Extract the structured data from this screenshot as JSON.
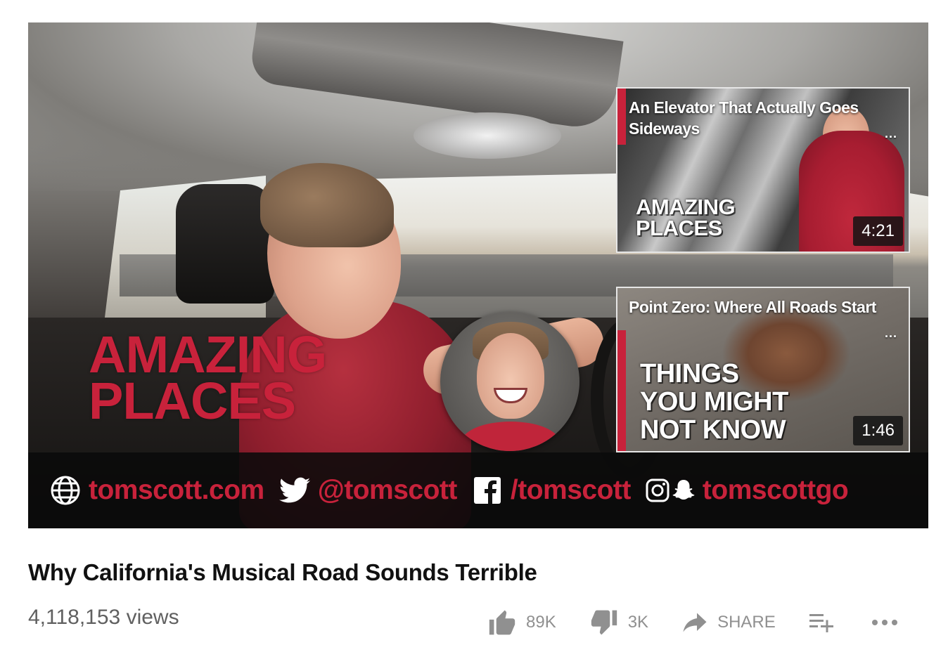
{
  "player": {
    "overlay_title_line1": "AMAZING",
    "overlay_title_line2": "PLACES",
    "end_cards": [
      {
        "title": "An Elevator That Actually Goes Sideways",
        "more": "...",
        "overlay_line1": "AMAZING",
        "overlay_line2": "PLACES",
        "duration": "4:21"
      },
      {
        "title": "Point Zero: Where All Roads Start",
        "more": "...",
        "overlay_line1": "THINGS",
        "overlay_line2": "YOU MIGHT",
        "overlay_line3": "NOT KNOW",
        "duration": "1:46"
      }
    ],
    "social": {
      "website": "tomscott.com",
      "twitter": "@tomscott",
      "facebook": "/tomscott",
      "instagram_snapchat": "tomscottgo"
    }
  },
  "video": {
    "title": "Why California's Musical Road Sounds Terrible",
    "views": "4,118,153 views"
  },
  "actions": {
    "likes": "89K",
    "dislikes": "3K",
    "share": "SHARE",
    "save_icon": "add-to-playlist-icon",
    "more_icon": "more-horizontal-icon"
  },
  "colors": {
    "accent_red": "#c8223b",
    "muted_gray": "#909090"
  }
}
